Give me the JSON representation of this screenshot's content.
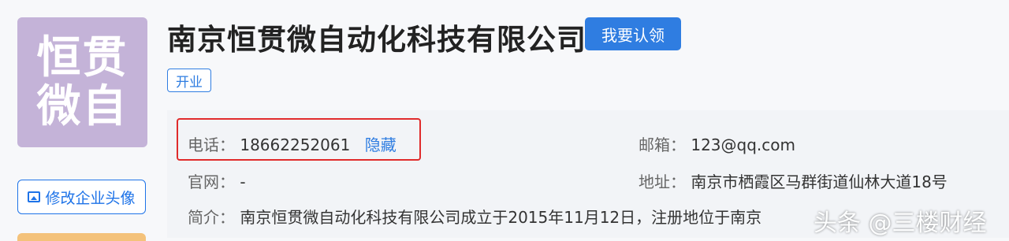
{
  "logo": {
    "line1": "恒贯",
    "line2": "微自"
  },
  "company": {
    "name": "南京恒贯微自动化科技有限公司",
    "status": "开业"
  },
  "actions": {
    "claim_label": "我要认领",
    "edit_logo_label": "修改企业头像"
  },
  "info": {
    "phone_label": "电话：",
    "phone_value": "18662252061",
    "phone_hide": "隐藏",
    "email_label": "邮箱：",
    "email_value": "123@qq.com",
    "website_label": "官网：",
    "website_value": "-",
    "address_label": "地址：",
    "address_value": "南京市栖霞区马群街道仙林大道18号",
    "intro_label": "简介：",
    "intro_value": "南京恒贯微自动化科技有限公司成立于2015年11月12日，注册地位于南京"
  },
  "watermark": "头条 @三楼财经",
  "colors": {
    "accent": "#2f7de1",
    "highlight": "#e02b2b",
    "logo_bg": "#c4b3d8"
  }
}
